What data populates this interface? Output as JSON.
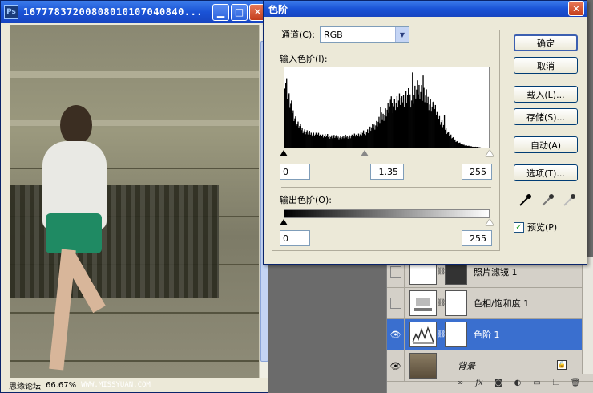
{
  "document": {
    "title": "16777837200808010107040840...",
    "ps_badge": "Ps",
    "zoom": "66.67%",
    "watermark": "WWW.MISSYUAN.COM",
    "forum": "思缘论坛"
  },
  "dialog": {
    "title": "色阶",
    "channel_label": "通道(C):",
    "channel_value": "RGB",
    "input_levels_label": "输入色阶(I):",
    "input_black": "0",
    "input_gamma": "1.35",
    "input_white": "255",
    "output_levels_label": "输出色阶(O):",
    "output_black": "0",
    "output_white": "255",
    "buttons": {
      "ok": "确定",
      "cancel": "取消",
      "load": "载入(L)...",
      "save": "存储(S)...",
      "auto": "自动(A)",
      "options": "选项(T)..."
    },
    "preview_label": "预览(P)",
    "preview_checked": true
  },
  "layers": {
    "items": [
      {
        "name": "照片滤镜 1",
        "visible": false
      },
      {
        "name": "色相/饱和度 1",
        "visible": false
      },
      {
        "name": "色阶 1",
        "visible": true,
        "selected": true
      },
      {
        "name": "背景",
        "visible": true
      }
    ]
  },
  "chart_data": {
    "type": "bar",
    "histogram_profile": [
      92,
      60,
      44,
      30,
      24,
      20,
      18,
      17,
      16,
      15,
      15,
      14,
      14,
      13,
      13,
      14,
      14,
      15,
      16,
      18,
      20,
      24,
      28,
      34,
      40,
      48,
      52,
      56,
      58,
      60,
      64,
      62,
      70,
      75,
      66,
      60,
      52,
      44,
      34,
      26,
      18,
      12,
      8,
      5,
      3,
      2,
      1,
      1,
      0,
      0
    ]
  }
}
